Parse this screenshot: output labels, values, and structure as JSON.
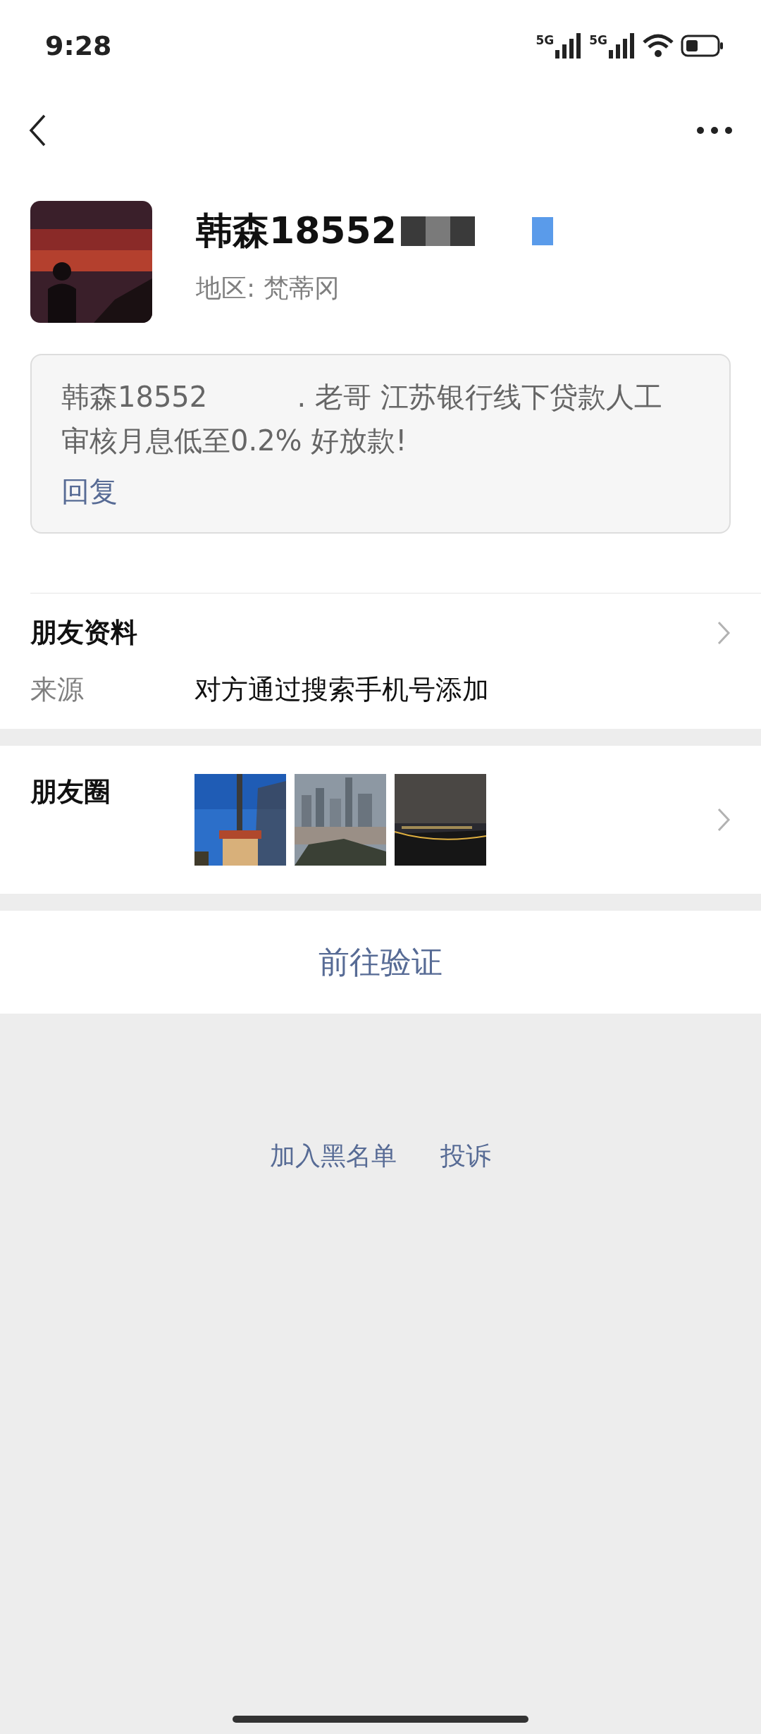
{
  "status_bar": {
    "time": "9:28",
    "network_1": "5G",
    "network_2": "5G"
  },
  "profile": {
    "name": "韩森18552",
    "region": "地区:  梵蒂冈",
    "redacted": true
  },
  "message": {
    "start": "韩森18552",
    "rest": ". 老哥 江苏银行线下贷款人工审核月息低至0.2% 好放款!",
    "reply": "回复"
  },
  "info": {
    "title": "朋友资料",
    "rows": [
      {
        "label": "来源",
        "value": "对方通过搜索手机号添加"
      }
    ]
  },
  "moments": {
    "title": "朋友圈"
  },
  "verify_button": "前往验证",
  "footer_links": [
    "加入黑名单",
    "投诉"
  ]
}
